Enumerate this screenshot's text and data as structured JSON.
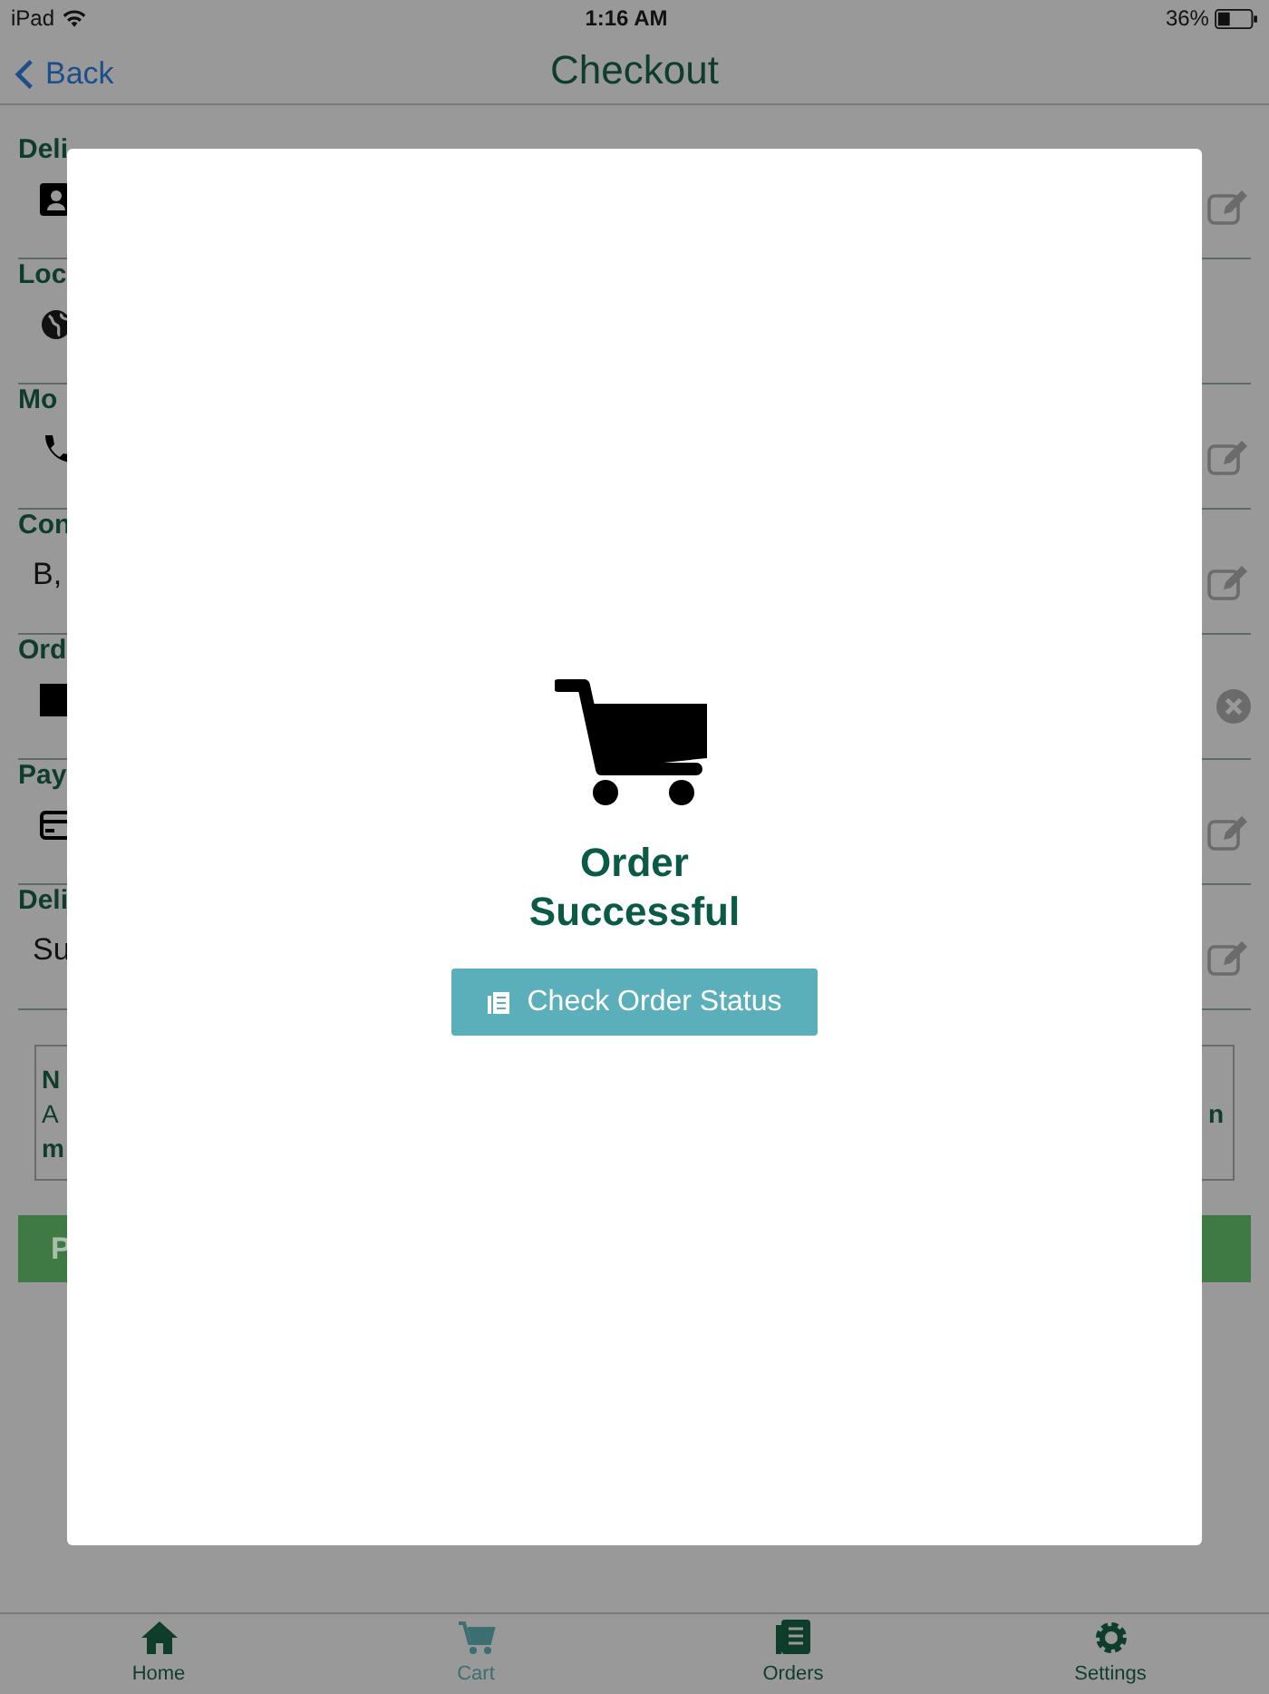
{
  "status_bar": {
    "device": "iPad",
    "time": "1:16 AM",
    "battery": "36%"
  },
  "nav": {
    "back": "Back",
    "title": "Checkout"
  },
  "rows": [
    {
      "label": "Deli",
      "kind": "icon",
      "editable": true,
      "clearable": false
    },
    {
      "label": "Loc",
      "kind": "icon",
      "editable": false,
      "clearable": false
    },
    {
      "label": "Mo",
      "kind": "icon",
      "editable": true,
      "clearable": false
    },
    {
      "label": "Con",
      "kind": "text",
      "value": "B,",
      "editable": true,
      "clearable": false
    },
    {
      "label": "Ord",
      "kind": "icon",
      "editable": false,
      "clearable": true
    },
    {
      "label": "Pay",
      "kind": "icon",
      "editable": true,
      "clearable": false
    },
    {
      "label": "Deli",
      "kind": "text",
      "value": "Su",
      "editable": true,
      "clearable": false
    }
  ],
  "note": {
    "lines": [
      "N",
      "A",
      "m"
    ],
    "right": "n"
  },
  "place_button": "P",
  "modal": {
    "title": "Order Successful",
    "button": "Check Order Status"
  },
  "tabs": [
    {
      "label": "Home",
      "selected": false
    },
    {
      "label": "Cart",
      "selected": true
    },
    {
      "label": "Orders",
      "selected": false
    },
    {
      "label": "Settings",
      "selected": false
    }
  ]
}
